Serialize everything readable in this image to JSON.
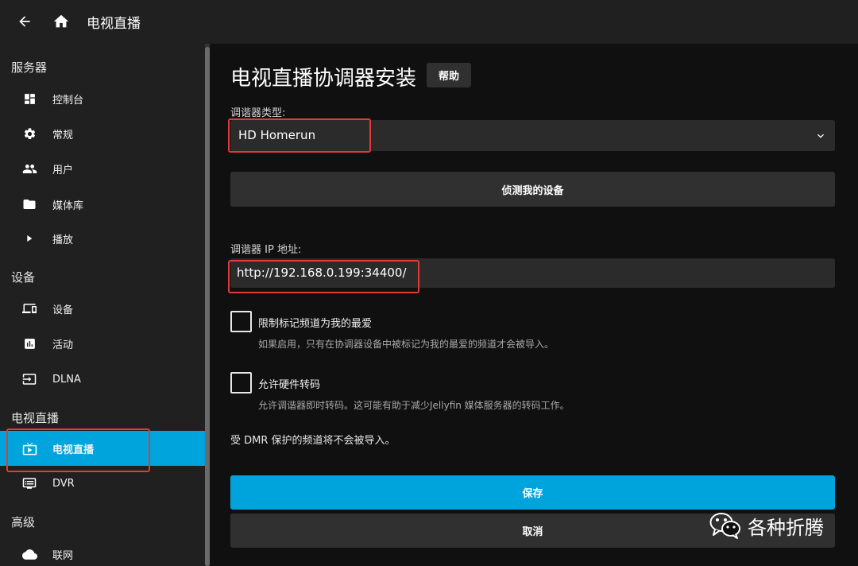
{
  "header": {
    "title": "电视直播",
    "back_icon": "arrow-left-icon",
    "home_icon": "home-icon"
  },
  "sidebar": {
    "sections": [
      {
        "title": "服务器",
        "items": [
          {
            "label": "控制台",
            "icon": "dashboard-icon"
          },
          {
            "label": "常规",
            "icon": "gear-icon"
          },
          {
            "label": "用户",
            "icon": "people-icon"
          },
          {
            "label": "媒体库",
            "icon": "folder-icon"
          },
          {
            "label": "播放",
            "icon": "play-icon"
          }
        ]
      },
      {
        "title": "设备",
        "items": [
          {
            "label": "设备",
            "icon": "devices-icon"
          },
          {
            "label": "活动",
            "icon": "assessment-icon"
          },
          {
            "label": "DLNA",
            "icon": "input-icon"
          }
        ]
      },
      {
        "title": "电视直播",
        "items": [
          {
            "label": "电视直播",
            "icon": "live-tv-icon",
            "active": true
          },
          {
            "label": "DVR",
            "icon": "dvr-icon"
          }
        ]
      },
      {
        "title": "高级",
        "items": [
          {
            "label": "联网",
            "icon": "cloud-icon"
          }
        ]
      }
    ]
  },
  "main": {
    "title": "电视直播协调器安装",
    "help_label": "帮助",
    "tuner_type_label": "调谐器类型:",
    "tuner_type_value": "HD Homerun",
    "detect_label": "侦测我的设备",
    "ip_label": "调谐器 IP 地址:",
    "ip_value": "http://192.168.0.199:34400/",
    "favorites_label": "限制标记频道为我的最爱",
    "favorites_desc": "如果启用，只有在协调器设备中被标记为我的最爱的频道才会被导入。",
    "favorites_checked": false,
    "transcode_label": "允许硬件转码",
    "transcode_desc": "允许调谐器即时转码。这可能有助于减少Jellyfin 媒体服务器的转码工作。",
    "transcode_checked": false,
    "drm_note": "受 DMR 保护的频道将不会被导入。",
    "save_label": "保存",
    "cancel_label": "取消"
  },
  "watermark": {
    "text": "各种折腾",
    "icon": "wechat-icon"
  },
  "colors": {
    "accent": "#00a4dc",
    "annotation": "#e23a3a",
    "background": "#101010",
    "panel": "#202020"
  }
}
